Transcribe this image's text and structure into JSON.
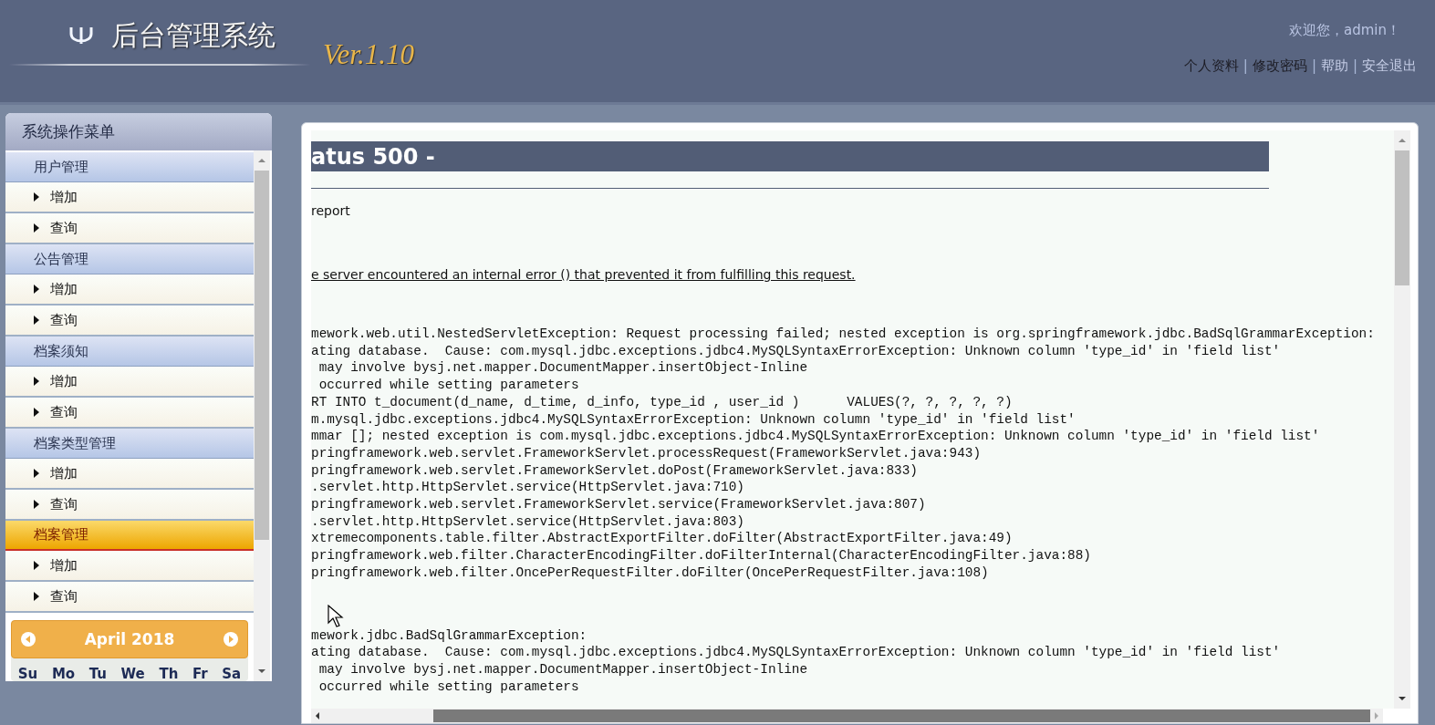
{
  "header": {
    "title": "后台管理系统",
    "version": "Ver.1.10",
    "welcome": "欢迎您，admin！",
    "links": [
      {
        "label": "个人资料",
        "visited": true
      },
      {
        "label": "修改密码",
        "visited": true
      },
      {
        "label": "帮助",
        "visited": false
      },
      {
        "label": "安全退出",
        "visited": false
      }
    ],
    "separator": "|"
  },
  "sidebar": {
    "title": "系统操作菜单",
    "groups": [
      {
        "title": "用户管理",
        "selected": false,
        "items": [
          "增加",
          "查询"
        ]
      },
      {
        "title": "公告管理",
        "selected": false,
        "items": [
          "增加",
          "查询"
        ]
      },
      {
        "title": "档案须知",
        "selected": false,
        "items": [
          "增加",
          "查询"
        ]
      },
      {
        "title": "档案类型管理",
        "selected": false,
        "items": [
          "增加",
          "查询"
        ]
      },
      {
        "title": "档案管理",
        "selected": true,
        "items": [
          "增加",
          "查询"
        ]
      }
    ],
    "calendar": {
      "month": "April 2018",
      "weekdays": [
        "Su",
        "Mo",
        "Tu",
        "We",
        "Th",
        "Fr",
        "Sa"
      ]
    }
  },
  "error_page": {
    "heading": "atus 500 -",
    "type_line": "report",
    "message": "e server encountered an internal error () that prevented it from fulfilling this request.",
    "exception_lines": [
      "mework.web.util.NestedServletException: Request processing failed; nested exception is org.springframework.jdbc.BadSqlGrammarException:",
      "ating database.  Cause: com.mysql.jdbc.exceptions.jdbc4.MySQLSyntaxErrorException: Unknown column 'type_id' in 'field list'",
      " may involve bysj.net.mapper.DocumentMapper.insertObject-Inline",
      " occurred while setting parameters",
      "RT INTO t_document(d_name, d_time, d_info, type_id , user_id )      VALUES(?, ?, ?, ?, ?)",
      "m.mysql.jdbc.exceptions.jdbc4.MySQLSyntaxErrorException: Unknown column 'type_id' in 'field list'",
      "mmar []; nested exception is com.mysql.jdbc.exceptions.jdbc4.MySQLSyntaxErrorException: Unknown column 'type_id' in 'field list'",
      "pringframework.web.servlet.FrameworkServlet.processRequest(FrameworkServlet.java:943)",
      "pringframework.web.servlet.FrameworkServlet.doPost(FrameworkServlet.java:833)",
      ".servlet.http.HttpServlet.service(HttpServlet.java:710)",
      "pringframework.web.servlet.FrameworkServlet.service(FrameworkServlet.java:807)",
      ".servlet.http.HttpServlet.service(HttpServlet.java:803)",
      "xtremecomponents.table.filter.AbstractExportFilter.doFilter(AbstractExportFilter.java:49)",
      "pringframework.web.filter.CharacterEncodingFilter.doFilterInternal(CharacterEncodingFilter.java:88)",
      "pringframework.web.filter.OncePerRequestFilter.doFilter(OncePerRequestFilter.java:108)"
    ],
    "root_cause_lines": [
      "mework.jdbc.BadSqlGrammarException:",
      "ating database.  Cause: com.mysql.jdbc.exceptions.jdbc4.MySQLSyntaxErrorException: Unknown column 'type_id' in 'field list'",
      " may involve bysj.net.mapper.DocumentMapper.insertObject-Inline",
      " occurred while setting parameters"
    ]
  }
}
